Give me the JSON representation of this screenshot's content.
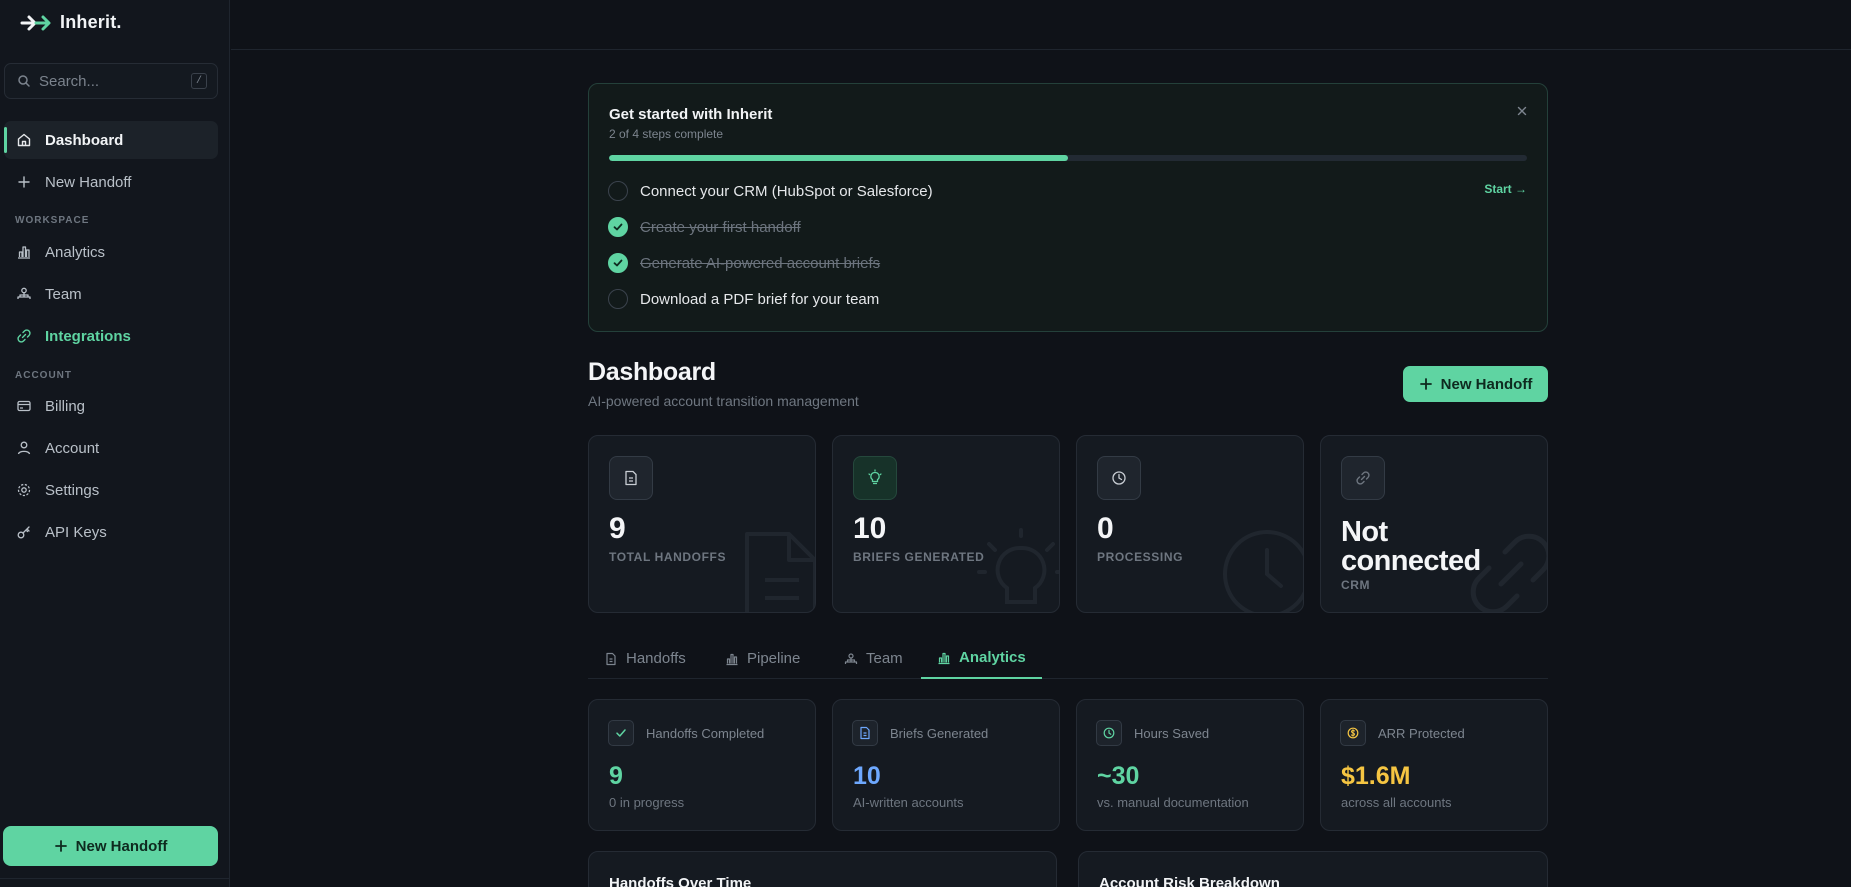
{
  "app": {
    "name": "Inherit."
  },
  "sidebar": {
    "search_placeholder": "Search...",
    "search_shortcut": "/",
    "primary": [
      {
        "label": "Dashboard",
        "icon": "home-icon"
      },
      {
        "label": "New Handoff",
        "icon": "plus-icon"
      }
    ],
    "workspace_label": "WORKSPACE",
    "workspace": [
      {
        "label": "Analytics",
        "icon": "bar-chart-icon"
      },
      {
        "label": "Team",
        "icon": "team-icon"
      },
      {
        "label": "Integrations",
        "icon": "link-icon"
      }
    ],
    "account_label": "ACCOUNT",
    "account": [
      {
        "label": "Billing",
        "icon": "credit-card-icon"
      },
      {
        "label": "Account",
        "icon": "user-icon"
      },
      {
        "label": "Settings",
        "icon": "gear-icon"
      },
      {
        "label": "API Keys",
        "icon": "key-icon"
      }
    ],
    "new_handoff_button": "New Handoff"
  },
  "onboarding": {
    "title": "Get started with Inherit",
    "subtitle": "2 of 4 steps complete",
    "progress": 0.5,
    "start_label": "Start →",
    "steps": [
      {
        "label": "Connect your CRM (HubSpot or Salesforce)",
        "done": false
      },
      {
        "label": "Create your first handoff",
        "done": true
      },
      {
        "label": "Generate AI-powered account briefs",
        "done": true
      },
      {
        "label": "Download a PDF brief for your team",
        "done": false
      }
    ]
  },
  "dashboard": {
    "title": "Dashboard",
    "subtitle": "AI-powered account transition management",
    "new_button": "New Handoff"
  },
  "stats": [
    {
      "value": "9",
      "label": "TOTAL HANDOFFS",
      "icon": "document-icon"
    },
    {
      "value": "10",
      "label": "BRIEFS GENERATED",
      "icon": "lightbulb-icon"
    },
    {
      "value": "0",
      "label": "PROCESSING",
      "icon": "clock-icon"
    },
    {
      "value_line1": "Not",
      "value_line2": "connected",
      "label": "CRM",
      "icon": "link-icon"
    }
  ],
  "tabs": [
    {
      "label": "Handoffs",
      "icon": "document-icon"
    },
    {
      "label": "Pipeline",
      "icon": "bar-chart-icon"
    },
    {
      "label": "Team",
      "icon": "team-icon"
    },
    {
      "label": "Analytics",
      "icon": "bar-chart-icon",
      "active": true
    }
  ],
  "metrics": [
    {
      "label": "Handoffs Completed",
      "value": "9",
      "sub": "0 in progress",
      "color": "#5fd4a2",
      "icon": "check-icon"
    },
    {
      "label": "Briefs Generated",
      "value": "10",
      "sub": "AI-written accounts",
      "color": "#6ea8fe",
      "icon": "document-icon"
    },
    {
      "label": "Hours Saved",
      "value": "~30",
      "sub": "vs. manual documentation",
      "color": "#5fd4a2",
      "icon": "clock-icon"
    },
    {
      "label": "ARR Protected",
      "value": "$1.6M",
      "sub": "across all accounts",
      "color": "#f5c542",
      "icon": "dollar-icon"
    }
  ],
  "panels": [
    {
      "title": "Handoffs Over Time"
    },
    {
      "title": "Account Risk Breakdown"
    }
  ],
  "colors": {
    "accent": "#5fd4a2",
    "background": "#0f1218",
    "blue": "#6ea8fe",
    "gold": "#f5c542"
  }
}
